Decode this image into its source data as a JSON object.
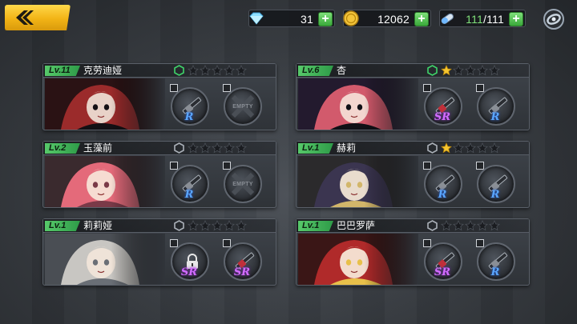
{
  "topbar": {
    "back_icon": "chevron-left-icon",
    "diamonds": "31",
    "gold": "12062",
    "stamina_current": "111",
    "stamina_max": "/111",
    "settings_icon": "settings-ring-icon"
  },
  "cards": [
    {
      "level": "Lv.11",
      "name": "克劳迪娅",
      "stars_filled": 0,
      "slots": [
        {
          "type": "weapon",
          "rarity": "R"
        },
        {
          "type": "empty",
          "label": "EMPTY"
        }
      ]
    },
    {
      "level": "Lv.6",
      "name": "杏",
      "stars_filled": 1,
      "slots": [
        {
          "type": "weapon",
          "rarity": "SR"
        },
        {
          "type": "weapon",
          "rarity": "R"
        }
      ]
    },
    {
      "level": "Lv.2",
      "name": "玉藻前",
      "stars_filled": 0,
      "slots": [
        {
          "type": "weapon",
          "rarity": "R"
        },
        {
          "type": "empty",
          "label": "EMPTY"
        }
      ]
    },
    {
      "level": "Lv.1",
      "name": "赫莉",
      "stars_filled": 1,
      "slots": [
        {
          "type": "weapon",
          "rarity": "R"
        },
        {
          "type": "weapon",
          "rarity": "R"
        }
      ]
    },
    {
      "level": "Lv.1",
      "name": "莉莉娅",
      "stars_filled": 0,
      "slots": [
        {
          "type": "locked",
          "rarity": "SR"
        },
        {
          "type": "weapon",
          "rarity": "SR"
        }
      ]
    },
    {
      "level": "Lv.1",
      "name": "巴巴罗萨",
      "stars_filled": 0,
      "slots": [
        {
          "type": "weapon",
          "rarity": "SR"
        },
        {
          "type": "weapon",
          "rarity": "R"
        }
      ]
    }
  ],
  "colors": {
    "accent": "#f2b416",
    "level_green": "#3fb85a",
    "plus_green": "#4cc04c",
    "rarity_r": "#5aa6ff",
    "rarity_sr": "#d26cff",
    "star_gold": "#f6c630"
  }
}
